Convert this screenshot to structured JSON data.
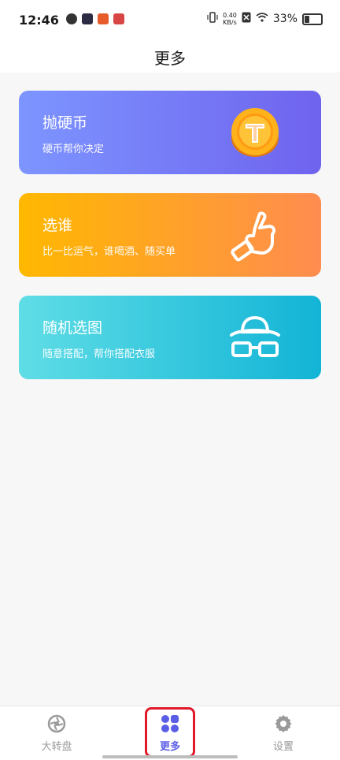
{
  "status_bar": {
    "time": "12:46",
    "speed_value": "0.40",
    "speed_unit": "KB/s",
    "battery": "33%"
  },
  "header": {
    "title": "更多"
  },
  "cards": [
    {
      "title": "抛硬币",
      "subtitle": "硬币帮你决定",
      "icon": "coin-icon"
    },
    {
      "title": "选谁",
      "subtitle": "比一比运气，谁喝酒、随买单",
      "icon": "pointing-hand-icon"
    },
    {
      "title": "随机选图",
      "subtitle": "随意搭配，帮你搭配衣服",
      "icon": "hat-glasses-icon"
    }
  ],
  "bottom_nav": [
    {
      "label": "大转盘",
      "icon": "wheel-icon",
      "active": false
    },
    {
      "label": "更多",
      "icon": "grid-icon",
      "active": true
    },
    {
      "label": "设置",
      "icon": "gear-icon",
      "active": false
    }
  ],
  "colors": {
    "accent": "#5b5ee6",
    "card1_gradient": [
      "#7d95ff",
      "#6f63ee"
    ],
    "card2_gradient": [
      "#ffb800",
      "#ff8c50"
    ],
    "card3_gradient": [
      "#5fdde6",
      "#12b4d6"
    ],
    "highlight": "#e11a2b"
  }
}
